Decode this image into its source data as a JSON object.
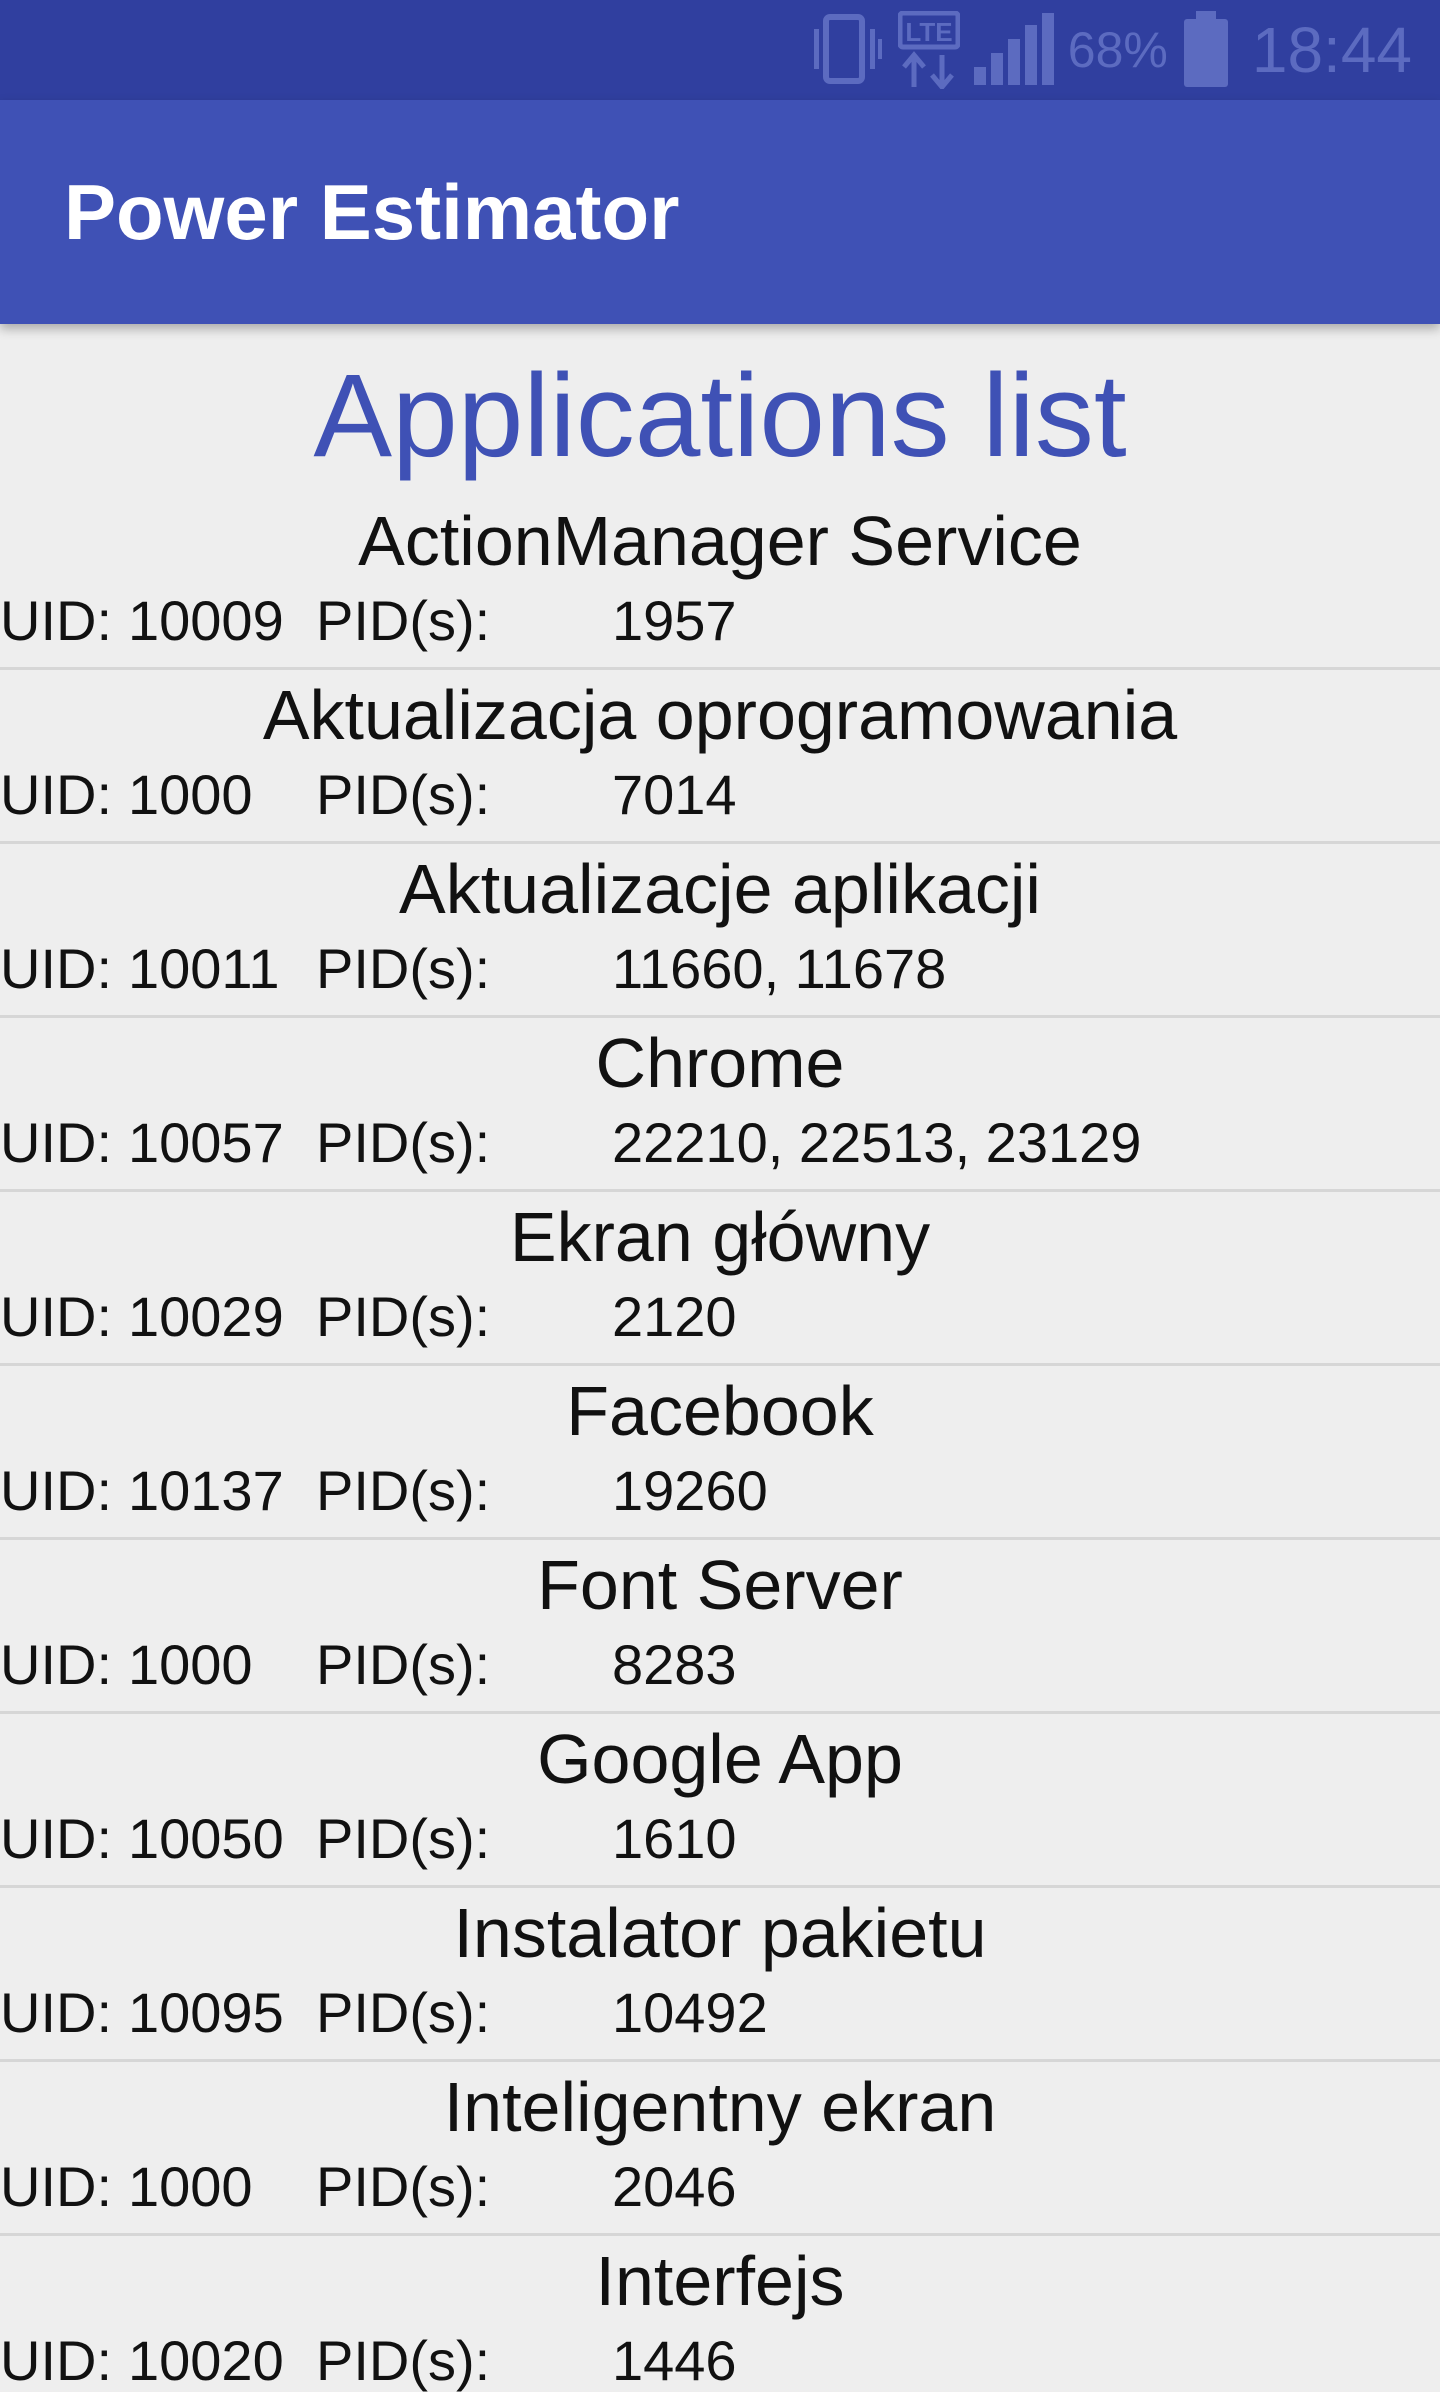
{
  "status_bar": {
    "icons": [
      "vibrate-icon",
      "lte-icon",
      "signal-icon",
      "battery-icon"
    ],
    "battery_percent": "68%",
    "time": "18:44"
  },
  "app_bar": {
    "title": "Power Estimator",
    "color": "#3f51b5"
  },
  "page": {
    "heading": "Applications list",
    "heading_color": "#3f51b5"
  },
  "list": {
    "uid_label": "UID:",
    "pid_label": "PID(s):",
    "items": [
      {
        "name": "ActionManager Service",
        "uid": "10009",
        "pids": "1957"
      },
      {
        "name": "Aktualizacja oprogramowania",
        "uid": "1000",
        "pids": "7014"
      },
      {
        "name": "Aktualizacje aplikacji",
        "uid": "10011",
        "pids": "11660, 11678"
      },
      {
        "name": "Chrome",
        "uid": "10057",
        "pids": "22210, 22513, 23129"
      },
      {
        "name": "Ekran główny",
        "uid": "10029",
        "pids": "2120"
      },
      {
        "name": "Facebook",
        "uid": "10137",
        "pids": "19260"
      },
      {
        "name": "Font Server",
        "uid": "1000",
        "pids": "8283"
      },
      {
        "name": "Google App",
        "uid": "10050",
        "pids": "1610"
      },
      {
        "name": "Instalator pakietu",
        "uid": "10095",
        "pids": "10492"
      },
      {
        "name": "Inteligentny ekran",
        "uid": "1000",
        "pids": "2046"
      },
      {
        "name": "Interfejs",
        "uid": "10020",
        "pids": "1446"
      }
    ]
  }
}
